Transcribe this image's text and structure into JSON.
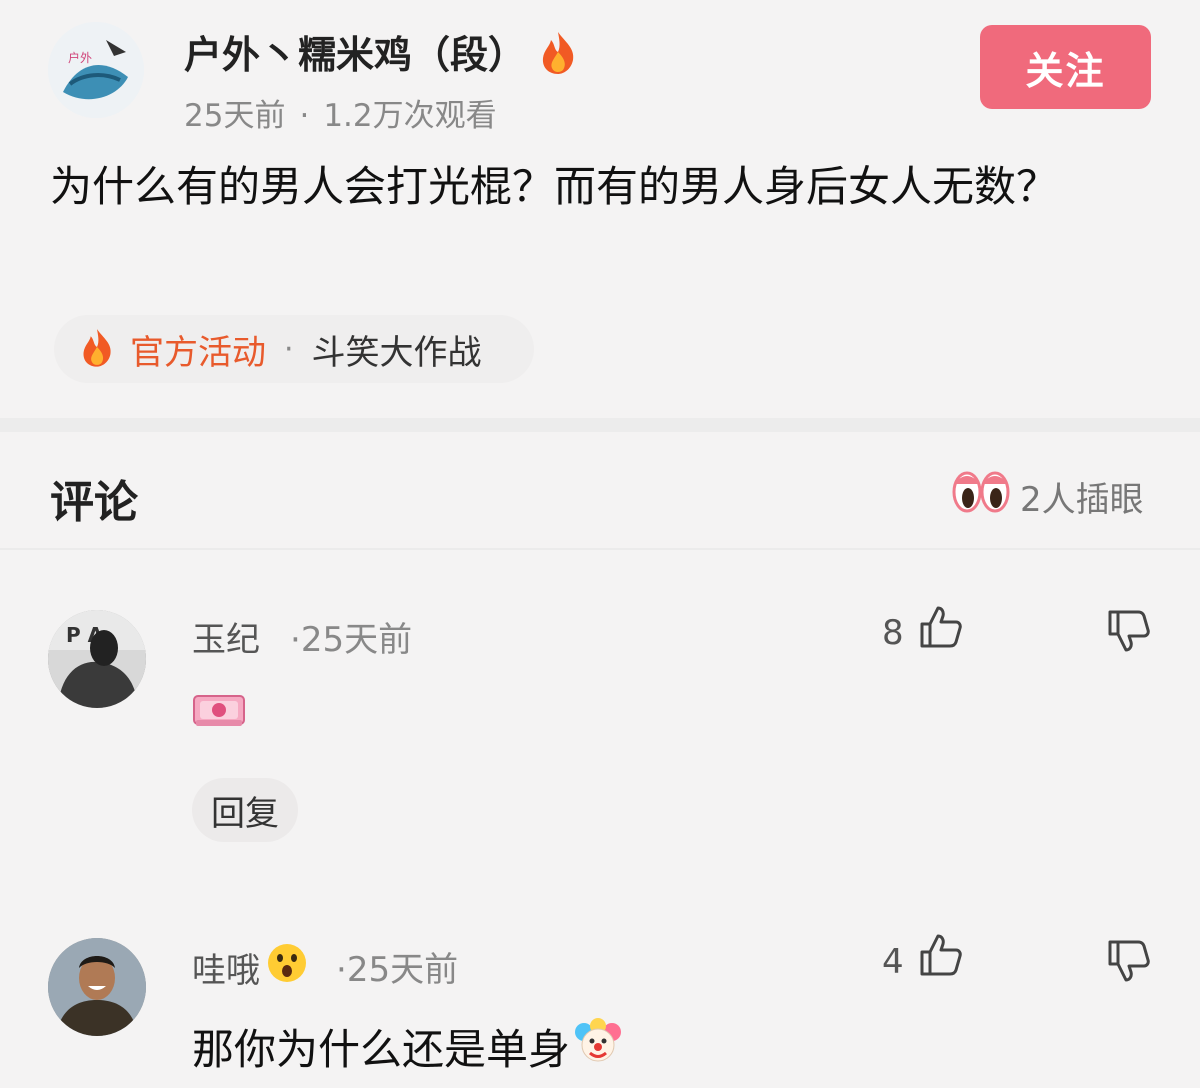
{
  "post": {
    "author": "户外丶糯米鸡（段）",
    "time": "25天前",
    "views": "1.2万次观看",
    "follow_label": "关注",
    "title": "为什么有的男人会打光棍？而有的男人身后女人无数？",
    "tag_label": "官方活动",
    "tag_topic": "斗笑大作战"
  },
  "comments_section": {
    "title": "评论",
    "watchers": "2人插眼"
  },
  "comments": [
    {
      "name": "玉纪",
      "time": "25天前",
      "likes": "8",
      "text": "",
      "reply_label": "回复"
    },
    {
      "name": "哇哦",
      "time": "25天前",
      "likes": "4",
      "text": "那你为什么还是单身"
    }
  ],
  "colors": {
    "accent": "#f06a7c",
    "tag_orange": "#e85a2c",
    "background": "#f4f3f3"
  },
  "icons": [
    "fire-icon",
    "eyes-icon",
    "thumb-up-icon",
    "thumb-down-icon",
    "money-emoji",
    "surprised-emoji",
    "clown-emoji"
  ]
}
